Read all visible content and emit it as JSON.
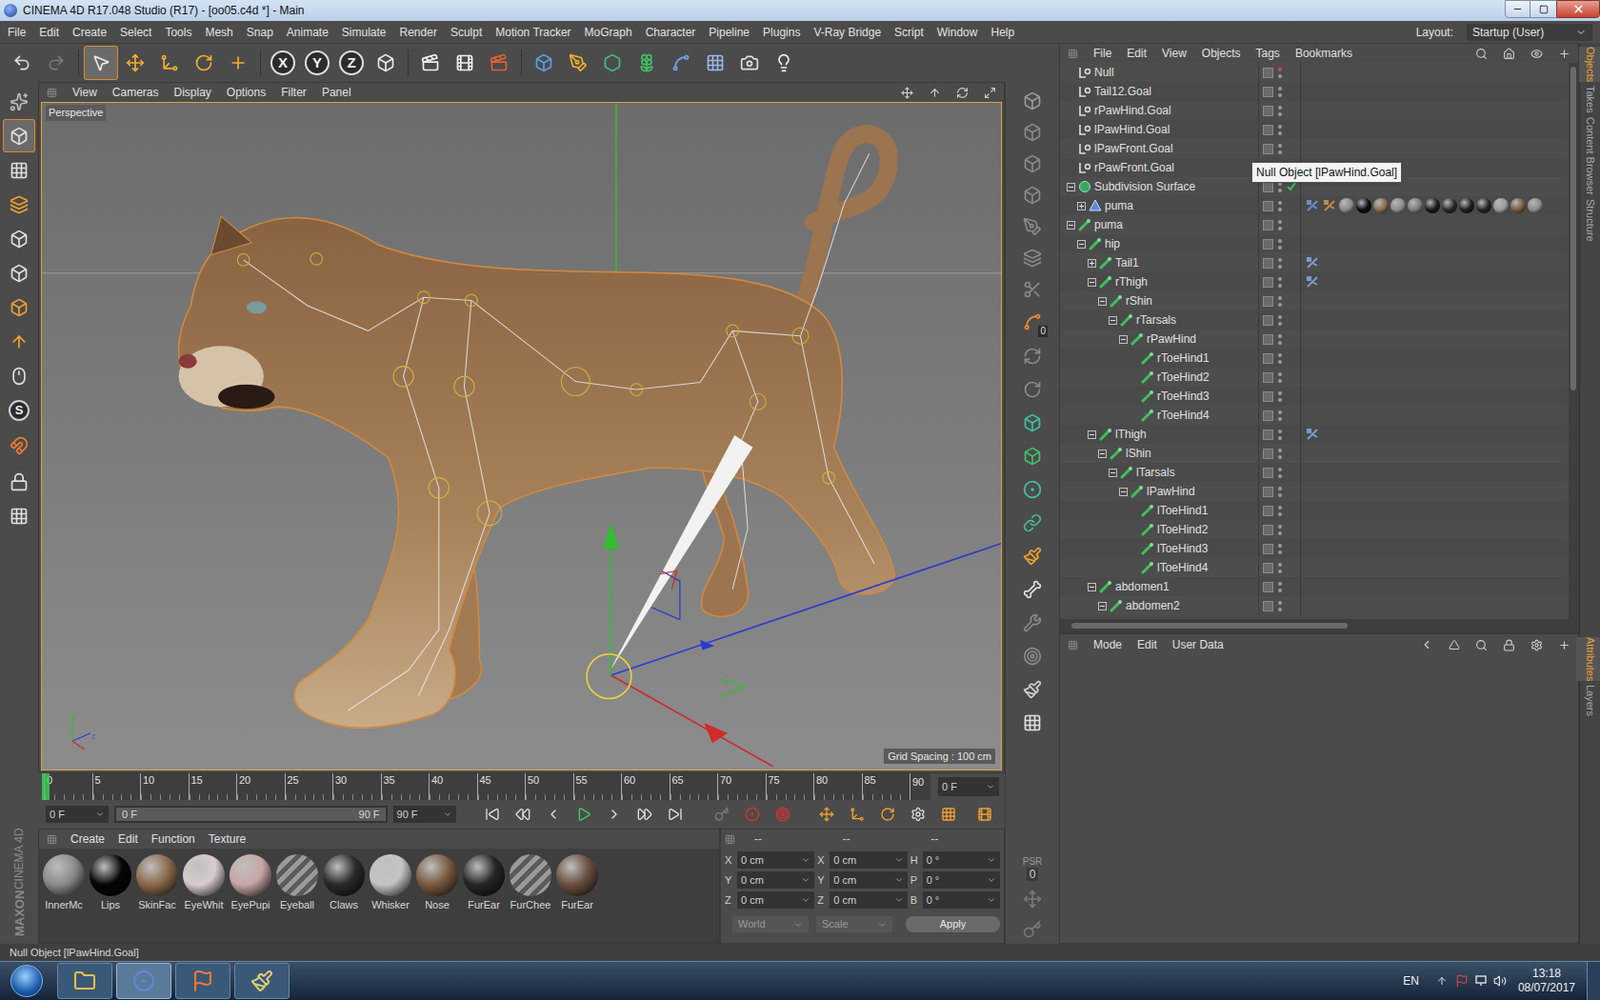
{
  "window": {
    "title": "CINEMA 4D R17.048 Studio (R17) - [oo05.c4d *] - Main"
  },
  "menu": [
    "File",
    "Edit",
    "Create",
    "Select",
    "Tools",
    "Mesh",
    "Snap",
    "Animate",
    "Simulate",
    "Render",
    "Sculpt",
    "Motion Tracker",
    "MoGraph",
    "Character",
    "Pipeline",
    "Plugins",
    "V-Ray Bridge",
    "Script",
    "Window",
    "Help"
  ],
  "layout": {
    "label": "Layout:",
    "value": "Startup (User)"
  },
  "toolbar": {
    "axis_buttons": [
      {
        "label": "X",
        "on": true
      },
      {
        "label": "Y",
        "on": true
      },
      {
        "label": "Z",
        "on": true
      }
    ]
  },
  "left_toolbar": {
    "snap_label": "S"
  },
  "right_toolbar": {
    "axis_badge": "0",
    "psr": "PSR",
    "psr_badge": "0"
  },
  "viewport": {
    "menu": [
      "View",
      "Cameras",
      "Display",
      "Options",
      "Filter",
      "Panel"
    ],
    "label": "Perspective",
    "grid_spacing": "Grid Spacing : 100 cm",
    "axis_gizmo": [
      "y",
      "z"
    ]
  },
  "object_manager": {
    "menu": [
      "File",
      "Edit",
      "View",
      "Objects",
      "Tags",
      "Bookmarks"
    ],
    "tooltip": "Null Object [lPawHind.Goal]",
    "rows": [
      {
        "name": "Null",
        "depth": 0,
        "kind": "null",
        "expander": false,
        "expanded": false,
        "dot": "#d04a4a",
        "check": false,
        "tags": []
      },
      {
        "name": "Tail12.Goal",
        "depth": 0,
        "kind": "null",
        "expander": false,
        "expanded": false,
        "dot": "#9a9a9a",
        "check": false,
        "tags": []
      },
      {
        "name": "rPawHind.Goal",
        "depth": 0,
        "kind": "null",
        "expander": false,
        "expanded": false,
        "dot": "#9a9a9a",
        "check": false,
        "tags": []
      },
      {
        "name": "lPawHind.Goal",
        "depth": 0,
        "kind": "null",
        "expander": false,
        "expanded": false,
        "dot": "#9a9a9a",
        "check": false,
        "tags": []
      },
      {
        "name": "lPawFront.Goal",
        "depth": 0,
        "kind": "null",
        "expander": false,
        "expanded": false,
        "dot": "#9a9a9a",
        "check": false,
        "tags": []
      },
      {
        "name": "rPawFront.Goal",
        "depth": 0,
        "kind": "null",
        "expander": false,
        "expanded": false,
        "dot": "#9a9a9a",
        "check": false,
        "tags": []
      },
      {
        "name": "Subdivision Surface",
        "depth": 0,
        "kind": "subdivision",
        "expander": true,
        "expanded": true,
        "dot": "#9a9a9a",
        "check": true,
        "tags": []
      },
      {
        "name": "puma",
        "depth": 1,
        "kind": "polygon",
        "expander": true,
        "expanded": false,
        "dot": "#9a9a9a",
        "check": false,
        "tags": [
          {
            "kind": "phong",
            "color": "#6a8cc8"
          },
          {
            "kind": "texture",
            "color": "#c08a48"
          },
          {
            "kind": "material",
            "color": "#8a8a8a"
          },
          {
            "kind": "material",
            "color": "#0a0a0a"
          },
          {
            "kind": "material",
            "color": "#8a6a4c"
          },
          {
            "kind": "material",
            "color": "#8c8c8c"
          },
          {
            "kind": "material",
            "color": "#7a7a7a"
          },
          {
            "kind": "material",
            "color": "#1a1a1a"
          },
          {
            "kind": "material",
            "color": "#2a2a2a"
          },
          {
            "kind": "material",
            "color": "#1e1e1e"
          },
          {
            "kind": "material",
            "color": "#262626"
          },
          {
            "kind": "material",
            "color": "#9a9a9a"
          },
          {
            "kind": "material",
            "color": "#7a5a40"
          },
          {
            "kind": "material",
            "color": "#8a8a8a"
          }
        ]
      },
      {
        "name": "puma",
        "depth": 0,
        "kind": "joint",
        "expander": true,
        "expanded": true,
        "dot": "#9a9a9a",
        "check": false,
        "tags": []
      },
      {
        "name": "hip",
        "depth": 1,
        "kind": "joint",
        "expander": true,
        "expanded": true,
        "dot": "#9a9a9a",
        "check": false,
        "tags": []
      },
      {
        "name": "Tail1",
        "depth": 2,
        "kind": "joint",
        "expander": true,
        "expanded": false,
        "dot": "#9a9a9a",
        "check": false,
        "tags": [
          {
            "kind": "ik",
            "color": "#7a9ad0"
          }
        ]
      },
      {
        "name": "rThigh",
        "depth": 2,
        "kind": "joint",
        "expander": true,
        "expanded": true,
        "dot": "#9a9a9a",
        "check": false,
        "tags": [
          {
            "kind": "ik",
            "color": "#7a9ad0"
          }
        ]
      },
      {
        "name": "rShin",
        "depth": 3,
        "kind": "joint",
        "expander": true,
        "expanded": true,
        "dot": "#9a9a9a",
        "check": false,
        "tags": []
      },
      {
        "name": "rTarsals",
        "depth": 4,
        "kind": "joint",
        "expander": true,
        "expanded": true,
        "dot": "#9a9a9a",
        "check": false,
        "tags": []
      },
      {
        "name": "rPawHind",
        "depth": 5,
        "kind": "joint",
        "expander": true,
        "expanded": true,
        "dot": "#9a9a9a",
        "check": false,
        "tags": []
      },
      {
        "name": "rToeHind1",
        "depth": 6,
        "kind": "joint",
        "expander": false,
        "expanded": false,
        "dot": "#9a9a9a",
        "check": false,
        "tags": []
      },
      {
        "name": "rToeHind2",
        "depth": 6,
        "kind": "joint",
        "expander": false,
        "expanded": false,
        "dot": "#9a9a9a",
        "check": false,
        "tags": []
      },
      {
        "name": "rToeHind3",
        "depth": 6,
        "kind": "joint",
        "expander": false,
        "expanded": false,
        "dot": "#9a9a9a",
        "check": false,
        "tags": []
      },
      {
        "name": "rToeHind4",
        "depth": 6,
        "kind": "joint",
        "expander": false,
        "expanded": false,
        "dot": "#9a9a9a",
        "check": false,
        "tags": []
      },
      {
        "name": "lThigh",
        "depth": 2,
        "kind": "joint",
        "expander": true,
        "expanded": true,
        "dot": "#9a9a9a",
        "check": false,
        "tags": [
          {
            "kind": "ik",
            "color": "#7a9ad0"
          }
        ]
      },
      {
        "name": "lShin",
        "depth": 3,
        "kind": "joint",
        "expander": true,
        "expanded": true,
        "dot": "#9a9a9a",
        "check": false,
        "tags": []
      },
      {
        "name": "lTarsals",
        "depth": 4,
        "kind": "joint",
        "expander": true,
        "expanded": true,
        "dot": "#9a9a9a",
        "check": false,
        "tags": []
      },
      {
        "name": "lPawHind",
        "depth": 5,
        "kind": "joint",
        "expander": true,
        "expanded": true,
        "dot": "#9a9a9a",
        "check": false,
        "tags": []
      },
      {
        "name": "lToeHind1",
        "depth": 6,
        "kind": "joint",
        "expander": false,
        "expanded": false,
        "dot": "#9a9a9a",
        "check": false,
        "tags": []
      },
      {
        "name": "lToeHind2",
        "depth": 6,
        "kind": "joint",
        "expander": false,
        "expanded": false,
        "dot": "#9a9a9a",
        "check": false,
        "tags": []
      },
      {
        "name": "lToeHind3",
        "depth": 6,
        "kind": "joint",
        "expander": false,
        "expanded": false,
        "dot": "#9a9a9a",
        "check": false,
        "tags": []
      },
      {
        "name": "lToeHind4",
        "depth": 6,
        "kind": "joint",
        "expander": false,
        "expanded": false,
        "dot": "#9a9a9a",
        "check": false,
        "tags": []
      },
      {
        "name": "abdomen1",
        "depth": 2,
        "kind": "joint",
        "expander": true,
        "expanded": true,
        "dot": "#9a9a9a",
        "check": false,
        "tags": []
      },
      {
        "name": "abdomen2",
        "depth": 3,
        "kind": "joint",
        "expander": true,
        "expanded": true,
        "dot": "#9a9a9a",
        "check": false,
        "tags": []
      }
    ]
  },
  "attributes": {
    "menu": [
      "Mode",
      "Edit",
      "User Data"
    ]
  },
  "side_tabs": [
    {
      "label": "Objects",
      "selected": true
    },
    {
      "label": "Takes",
      "selected": false
    },
    {
      "label": "Content Browser",
      "selected": false
    },
    {
      "label": "Structure",
      "selected": false
    }
  ],
  "side_tabs_bottom": [
    {
      "label": "Attributes",
      "selected": true
    },
    {
      "label": "Layers",
      "selected": false
    }
  ],
  "timeline": {
    "ticks": [
      "0",
      "5",
      "10",
      "15",
      "20",
      "25",
      "30",
      "35",
      "40",
      "45",
      "50",
      "55",
      "60",
      "65",
      "70",
      "75",
      "80",
      "85",
      "90"
    ],
    "current": "0 F",
    "level": 0
  },
  "playback": {
    "start": "0 F",
    "range_start": "0 F",
    "range_end": "90 F",
    "end": "90 F"
  },
  "materials": {
    "menu": [
      "Create",
      "Edit",
      "Function",
      "Texture"
    ],
    "items": [
      {
        "name": "InnerMc",
        "color": "#8a8a8a",
        "kind": "sphere"
      },
      {
        "name": "Lips",
        "color": "#050505",
        "kind": "sphere"
      },
      {
        "name": "SkinFac",
        "color": "#8a6a4c",
        "kind": "sphere"
      },
      {
        "name": "EyeWhit",
        "color": "#d8cccc",
        "kind": "sphere"
      },
      {
        "name": "EyePupi",
        "color": "#c8a6a6",
        "kind": "sphere"
      },
      {
        "name": "Eyeball",
        "color": "#9a9a9a",
        "kind": "hatched"
      },
      {
        "name": "Claws",
        "color": "#2a2a2a",
        "kind": "sphere"
      },
      {
        "name": "Whisker",
        "color": "#c4c4c4",
        "kind": "sphere"
      },
      {
        "name": "Nose",
        "color": "#7a5a40",
        "kind": "sphere"
      },
      {
        "name": "FurEar",
        "color": "#262626",
        "kind": "sphere"
      },
      {
        "name": "FurChee",
        "color": "#9a9a9a",
        "kind": "hatched"
      },
      {
        "name": "FurEar",
        "color": "#6a5040",
        "kind": "sphere"
      }
    ]
  },
  "coordinates": {
    "headers": [
      "--",
      "--",
      "--"
    ],
    "rows": [
      {
        "axis": "X",
        "position": "0 cm",
        "size_axis": "X",
        "size": "0 cm",
        "rot_axis": "H",
        "rotation": "0 °"
      },
      {
        "axis": "Y",
        "position": "0 cm",
        "size_axis": "Y",
        "size": "0 cm",
        "rot_axis": "P",
        "rotation": "0 °"
      },
      {
        "axis": "Z",
        "position": "0 cm",
        "size_axis": "Z",
        "size": "0 cm",
        "rot_axis": "B",
        "rotation": "0 °"
      }
    ],
    "mode": "World",
    "size_mode": "Scale",
    "apply": "Apply"
  },
  "logo": [
    "MAXON",
    "CINEMA 4D"
  ],
  "status_bar": "Null Object [lPawHind.Goal]",
  "taskbar": {
    "language": "EN",
    "time": "13:18",
    "date": "08/07/2017"
  }
}
